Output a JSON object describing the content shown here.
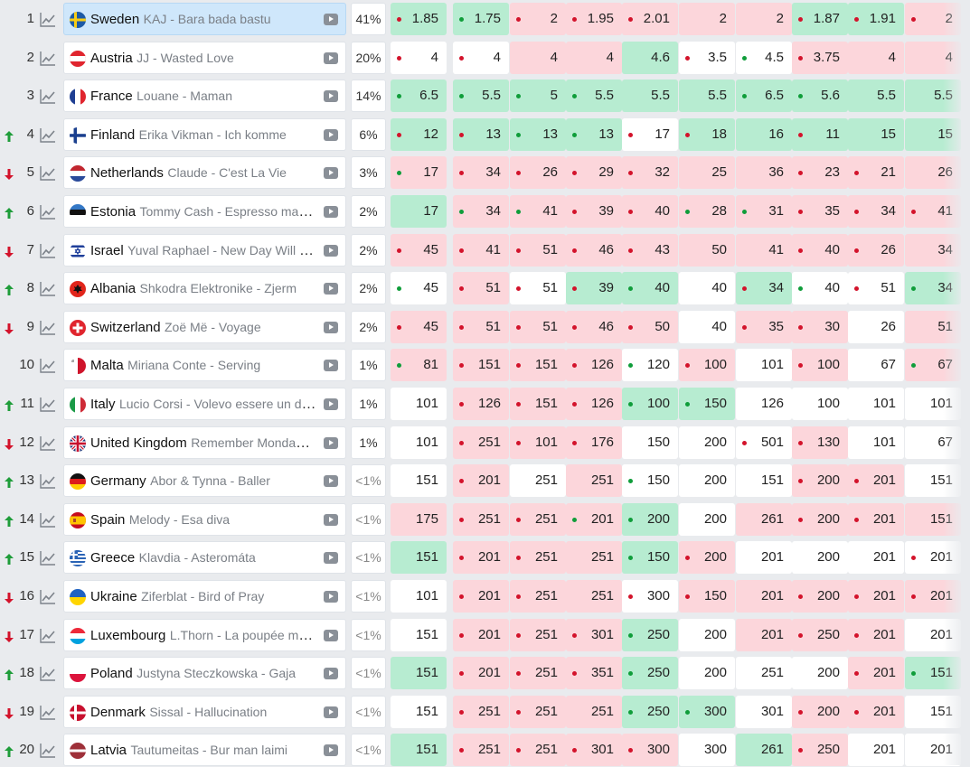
{
  "colors": {
    "green_cell": "#b7ecd1",
    "red_cell": "#fcd6db",
    "white_cell": "#ffffff",
    "up_arrow": "#1f9d3a",
    "down_arrow": "#d3132b",
    "selected_row": "#cfe7fb"
  },
  "rows": [
    {
      "rank": "1",
      "trend": "none",
      "country": "Sweden",
      "artist": "KAJ - Bara bada bastu",
      "pct": "41%",
      "flag": "sweden",
      "selected": true,
      "odds": [
        [
          "1.85",
          "g",
          "r"
        ],
        [
          "1.75",
          "g",
          "g"
        ],
        [
          "2",
          "r",
          "r"
        ],
        [
          "1.95",
          "r",
          "r"
        ],
        [
          "2.01",
          "r",
          "r"
        ],
        [
          "2",
          "r",
          ""
        ],
        [
          "2",
          "r",
          ""
        ],
        [
          "1.87",
          "g",
          "r"
        ],
        [
          "1.91",
          "g",
          "r"
        ],
        [
          "2",
          "r",
          "r"
        ]
      ]
    },
    {
      "rank": "2",
      "trend": "none",
      "country": "Austria",
      "artist": "JJ - Wasted Love",
      "pct": "20%",
      "flag": "austria",
      "odds": [
        [
          "4",
          "w",
          "r"
        ],
        [
          "4",
          "w",
          "r"
        ],
        [
          "4",
          "r",
          ""
        ],
        [
          "4",
          "r",
          ""
        ],
        [
          "4.6",
          "g",
          ""
        ],
        [
          "3.5",
          "w",
          "r"
        ],
        [
          "4.5",
          "w",
          "g"
        ],
        [
          "3.75",
          "r",
          "r"
        ],
        [
          "4",
          "r",
          ""
        ],
        [
          "4",
          "r",
          ""
        ]
      ]
    },
    {
      "rank": "3",
      "trend": "none",
      "country": "France",
      "artist": "Louane - Maman",
      "pct": "14%",
      "flag": "france",
      "odds": [
        [
          "6.5",
          "g",
          "g"
        ],
        [
          "5.5",
          "g",
          "g"
        ],
        [
          "5",
          "g",
          "g"
        ],
        [
          "5.5",
          "g",
          "g"
        ],
        [
          "5.5",
          "g",
          ""
        ],
        [
          "5.5",
          "g",
          ""
        ],
        [
          "6.5",
          "g",
          "g"
        ],
        [
          "5.6",
          "g",
          "g"
        ],
        [
          "5.5",
          "g",
          ""
        ],
        [
          "5.5",
          "g",
          ""
        ]
      ]
    },
    {
      "rank": "4",
      "trend": "up",
      "country": "Finland",
      "artist": "Erika Vikman - Ich komme",
      "pct": "6%",
      "flag": "finland",
      "odds": [
        [
          "12",
          "g",
          "r"
        ],
        [
          "13",
          "g",
          "r"
        ],
        [
          "13",
          "g",
          "g"
        ],
        [
          "13",
          "g",
          "g"
        ],
        [
          "17",
          "w",
          "r"
        ],
        [
          "18",
          "g",
          "r"
        ],
        [
          "16",
          "g",
          ""
        ],
        [
          "11",
          "g",
          "r"
        ],
        [
          "15",
          "g",
          ""
        ],
        [
          "15",
          "g",
          ""
        ]
      ]
    },
    {
      "rank": "5",
      "trend": "down",
      "country": "Netherlands",
      "artist": "Claude - C'est La Vie",
      "pct": "3%",
      "flag": "netherlands",
      "odds": [
        [
          "17",
          "r",
          "g"
        ],
        [
          "34",
          "r",
          "r"
        ],
        [
          "26",
          "r",
          "r"
        ],
        [
          "29",
          "r",
          "r"
        ],
        [
          "32",
          "r",
          "r"
        ],
        [
          "25",
          "r",
          ""
        ],
        [
          "36",
          "r",
          ""
        ],
        [
          "23",
          "r",
          "r"
        ],
        [
          "21",
          "r",
          "r"
        ],
        [
          "26",
          "r",
          ""
        ]
      ]
    },
    {
      "rank": "6",
      "trend": "up",
      "country": "Estonia",
      "artist": "Tommy Cash - Espresso macchiato",
      "pct": "2%",
      "flag": "estonia",
      "odds": [
        [
          "17",
          "g",
          ""
        ],
        [
          "34",
          "r",
          "g"
        ],
        [
          "41",
          "r",
          "g"
        ],
        [
          "39",
          "r",
          "r"
        ],
        [
          "40",
          "r",
          "r"
        ],
        [
          "28",
          "r",
          "g"
        ],
        [
          "31",
          "r",
          "g"
        ],
        [
          "35",
          "r",
          "r"
        ],
        [
          "34",
          "r",
          "r"
        ],
        [
          "41",
          "r",
          "r"
        ]
      ]
    },
    {
      "rank": "7",
      "trend": "down",
      "country": "Israel",
      "artist": "Yuval Raphael - New Day Will Rise",
      "pct": "2%",
      "flag": "israel",
      "odds": [
        [
          "45",
          "r",
          "r"
        ],
        [
          "41",
          "r",
          "r"
        ],
        [
          "51",
          "r",
          "r"
        ],
        [
          "46",
          "r",
          "r"
        ],
        [
          "43",
          "r",
          "r"
        ],
        [
          "50",
          "r",
          ""
        ],
        [
          "41",
          "r",
          ""
        ],
        [
          "40",
          "r",
          "r"
        ],
        [
          "26",
          "r",
          "r"
        ],
        [
          "34",
          "r",
          ""
        ]
      ]
    },
    {
      "rank": "8",
      "trend": "up",
      "country": "Albania",
      "artist": "Shkodra Elektronike - Zjerm",
      "pct": "2%",
      "flag": "albania",
      "odds": [
        [
          "45",
          "w",
          "g"
        ],
        [
          "51",
          "r",
          "r"
        ],
        [
          "51",
          "w",
          "r"
        ],
        [
          "39",
          "g",
          "r"
        ],
        [
          "40",
          "g",
          "g"
        ],
        [
          "40",
          "w",
          ""
        ],
        [
          "34",
          "g",
          "r"
        ],
        [
          "40",
          "w",
          "g"
        ],
        [
          "51",
          "w",
          "r"
        ],
        [
          "34",
          "g",
          "g"
        ]
      ]
    },
    {
      "rank": "9",
      "trend": "down",
      "country": "Switzerland",
      "artist": "Zoë Më - Voyage",
      "pct": "2%",
      "flag": "switzerland",
      "odds": [
        [
          "45",
          "r",
          "r"
        ],
        [
          "51",
          "r",
          "r"
        ],
        [
          "51",
          "r",
          "r"
        ],
        [
          "46",
          "r",
          "r"
        ],
        [
          "50",
          "r",
          "r"
        ],
        [
          "40",
          "w",
          ""
        ],
        [
          "35",
          "r",
          "r"
        ],
        [
          "30",
          "r",
          "r"
        ],
        [
          "26",
          "w",
          ""
        ],
        [
          "51",
          "r",
          ""
        ]
      ]
    },
    {
      "rank": "10",
      "trend": "none",
      "country": "Malta",
      "artist": "Miriana Conte - Serving",
      "pct": "1%",
      "flag": "malta",
      "odds": [
        [
          "81",
          "r",
          "g"
        ],
        [
          "151",
          "r",
          "r"
        ],
        [
          "151",
          "r",
          "r"
        ],
        [
          "126",
          "r",
          "r"
        ],
        [
          "120",
          "w",
          "g"
        ],
        [
          "100",
          "r",
          "r"
        ],
        [
          "101",
          "w",
          ""
        ],
        [
          "100",
          "r",
          "r"
        ],
        [
          "67",
          "w",
          ""
        ],
        [
          "67",
          "r",
          "g"
        ]
      ]
    },
    {
      "rank": "11",
      "trend": "up",
      "country": "Italy",
      "artist": "Lucio Corsi - Volevo essere un duro",
      "pct": "1%",
      "flag": "italy",
      "odds": [
        [
          "101",
          "w",
          ""
        ],
        [
          "126",
          "r",
          "r"
        ],
        [
          "151",
          "r",
          "r"
        ],
        [
          "126",
          "r",
          "r"
        ],
        [
          "100",
          "g",
          "g"
        ],
        [
          "150",
          "g",
          "g"
        ],
        [
          "126",
          "w",
          ""
        ],
        [
          "100",
          "w",
          ""
        ],
        [
          "101",
          "w",
          ""
        ],
        [
          "101",
          "w",
          ""
        ]
      ]
    },
    {
      "rank": "12",
      "trend": "down",
      "country": "United Kingdom",
      "artist": "Remember Monday - What The Hell Just Happened?",
      "pct": "1%",
      "flag": "uk",
      "odds": [
        [
          "101",
          "w",
          ""
        ],
        [
          "251",
          "r",
          "r"
        ],
        [
          "101",
          "r",
          "r"
        ],
        [
          "176",
          "r",
          "r"
        ],
        [
          "150",
          "w",
          ""
        ],
        [
          "200",
          "w",
          ""
        ],
        [
          "501",
          "w",
          "r"
        ],
        [
          "130",
          "r",
          "r"
        ],
        [
          "101",
          "w",
          ""
        ],
        [
          "67",
          "w",
          ""
        ]
      ]
    },
    {
      "rank": "13",
      "trend": "up",
      "country": "Germany",
      "artist": "Abor & Tynna - Baller",
      "pct": "<1%",
      "flag": "germany",
      "odds": [
        [
          "151",
          "w",
          ""
        ],
        [
          "201",
          "r",
          "r"
        ],
        [
          "251",
          "w",
          ""
        ],
        [
          "251",
          "r",
          ""
        ],
        [
          "150",
          "w",
          "g"
        ],
        [
          "200",
          "w",
          ""
        ],
        [
          "151",
          "w",
          ""
        ],
        [
          "200",
          "r",
          "r"
        ],
        [
          "201",
          "r",
          "r"
        ],
        [
          "151",
          "w",
          ""
        ]
      ]
    },
    {
      "rank": "14",
      "trend": "up",
      "country": "Spain",
      "artist": "Melody - Esa diva",
      "pct": "<1%",
      "flag": "spain",
      "odds": [
        [
          "175",
          "r",
          ""
        ],
        [
          "251",
          "r",
          "r"
        ],
        [
          "251",
          "r",
          "r"
        ],
        [
          "201",
          "r",
          "g"
        ],
        [
          "200",
          "g",
          "g"
        ],
        [
          "200",
          "w",
          ""
        ],
        [
          "261",
          "r",
          ""
        ],
        [
          "200",
          "r",
          "r"
        ],
        [
          "201",
          "r",
          "r"
        ],
        [
          "151",
          "r",
          ""
        ]
      ]
    },
    {
      "rank": "15",
      "trend": "up",
      "country": "Greece",
      "artist": "Klavdia - Asteromáta",
      "pct": "<1%",
      "flag": "greece",
      "odds": [
        [
          "151",
          "g",
          ""
        ],
        [
          "201",
          "r",
          "r"
        ],
        [
          "251",
          "r",
          "r"
        ],
        [
          "251",
          "r",
          ""
        ],
        [
          "150",
          "g",
          "g"
        ],
        [
          "200",
          "r",
          "r"
        ],
        [
          "201",
          "w",
          ""
        ],
        [
          "200",
          "w",
          ""
        ],
        [
          "201",
          "w",
          ""
        ],
        [
          "201",
          "w",
          "r"
        ]
      ]
    },
    {
      "rank": "16",
      "trend": "down",
      "country": "Ukraine",
      "artist": "Ziferblat - Bird of Pray",
      "pct": "<1%",
      "flag": "ukraine",
      "odds": [
        [
          "101",
          "w",
          ""
        ],
        [
          "201",
          "r",
          "r"
        ],
        [
          "251",
          "r",
          "r"
        ],
        [
          "251",
          "r",
          ""
        ],
        [
          "300",
          "w",
          "r"
        ],
        [
          "150",
          "r",
          "r"
        ],
        [
          "201",
          "r",
          ""
        ],
        [
          "200",
          "r",
          "r"
        ],
        [
          "201",
          "r",
          "r"
        ],
        [
          "201",
          "r",
          "r"
        ]
      ]
    },
    {
      "rank": "17",
      "trend": "down",
      "country": "Luxembourg",
      "artist": "L.Thorn - La poupée monte le son",
      "pct": "<1%",
      "flag": "luxembourg",
      "odds": [
        [
          "151",
          "w",
          ""
        ],
        [
          "201",
          "r",
          "r"
        ],
        [
          "251",
          "r",
          "r"
        ],
        [
          "301",
          "r",
          "r"
        ],
        [
          "250",
          "g",
          "g"
        ],
        [
          "200",
          "w",
          ""
        ],
        [
          "201",
          "r",
          ""
        ],
        [
          "250",
          "r",
          "r"
        ],
        [
          "201",
          "r",
          "r"
        ],
        [
          "201",
          "w",
          ""
        ]
      ]
    },
    {
      "rank": "18",
      "trend": "up",
      "country": "Poland",
      "artist": "Justyna Steczkowska - Gaja",
      "pct": "<1%",
      "flag": "poland",
      "odds": [
        [
          "151",
          "g",
          ""
        ],
        [
          "201",
          "r",
          "r"
        ],
        [
          "251",
          "r",
          "r"
        ],
        [
          "351",
          "r",
          "r"
        ],
        [
          "250",
          "g",
          "g"
        ],
        [
          "200",
          "w",
          ""
        ],
        [
          "251",
          "w",
          ""
        ],
        [
          "200",
          "w",
          ""
        ],
        [
          "201",
          "r",
          "r"
        ],
        [
          "151",
          "g",
          "g"
        ]
      ]
    },
    {
      "rank": "19",
      "trend": "down",
      "country": "Denmark",
      "artist": "Sissal - Hallucination",
      "pct": "<1%",
      "flag": "denmark",
      "odds": [
        [
          "151",
          "w",
          ""
        ],
        [
          "251",
          "r",
          "r"
        ],
        [
          "251",
          "r",
          "r"
        ],
        [
          "251",
          "r",
          ""
        ],
        [
          "250",
          "g",
          "g"
        ],
        [
          "300",
          "g",
          "g"
        ],
        [
          "301",
          "w",
          ""
        ],
        [
          "200",
          "r",
          "r"
        ],
        [
          "201",
          "r",
          "r"
        ],
        [
          "151",
          "w",
          ""
        ]
      ]
    },
    {
      "rank": "20",
      "trend": "up",
      "country": "Latvia",
      "artist": "Tautumeitas - Bur man laimi",
      "pct": "<1%",
      "flag": "latvia",
      "odds": [
        [
          "151",
          "g",
          ""
        ],
        [
          "251",
          "r",
          "r"
        ],
        [
          "251",
          "r",
          "r"
        ],
        [
          "301",
          "r",
          "r"
        ],
        [
          "300",
          "r",
          "r"
        ],
        [
          "300",
          "w",
          ""
        ],
        [
          "261",
          "g",
          ""
        ],
        [
          "250",
          "r",
          "r"
        ],
        [
          "201",
          "w",
          ""
        ],
        [
          "201",
          "w",
          ""
        ]
      ]
    }
  ]
}
